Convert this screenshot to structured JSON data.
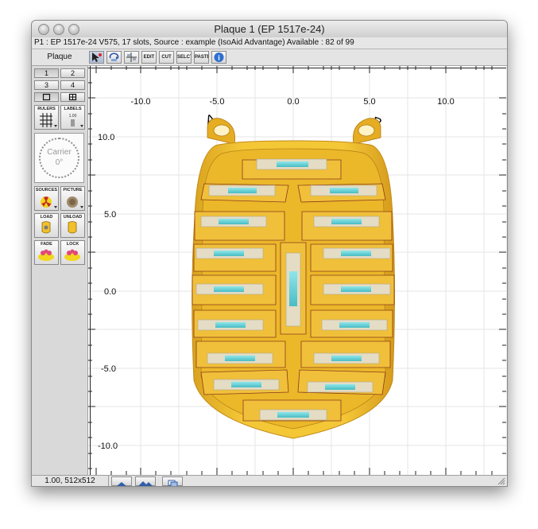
{
  "window": {
    "title": "Plaque 1 (EP 1517e-24)",
    "info": "P1 : EP 1517e-24 V575, 17 slots, Source : example (IsoAid Advantage) Available : 82 of 99"
  },
  "toolbar": {
    "plaque_label": "Plaque",
    "buttons": [
      {
        "name": "select-tool-button",
        "label": ""
      },
      {
        "name": "rotate-tool-button",
        "label": ""
      },
      {
        "name": "align-tool-button",
        "label": ""
      },
      {
        "name": "edit-button",
        "label": "EDIT"
      },
      {
        "name": "cut-button",
        "label": "CUT"
      },
      {
        "name": "select-all-button",
        "label": "SELCT"
      },
      {
        "name": "paste-button",
        "label": "PASTE"
      },
      {
        "name": "info-button",
        "label": "i"
      }
    ]
  },
  "palette": {
    "view_buttons": [
      "1",
      "2",
      "3",
      "4"
    ],
    "rulers_label": "RULERS",
    "labels_label": "LABELS",
    "labels_scale": "1.00",
    "carrier_label": "Carrier",
    "carrier_angle": "0°",
    "sources_label": "SOURCES",
    "picture_label": "PICTURE",
    "load_label": "LOAD",
    "unload_label": "UNLOAD",
    "fade_label": "FADE",
    "lock_label": "LOCK"
  },
  "status": {
    "zoom": "1.00, 512x512"
  },
  "plot": {
    "x_ticks": [
      "-10.0",
      "-5.0",
      "0.0",
      "5.0",
      "10.0"
    ],
    "y_ticks": [
      "10.0",
      "5.0",
      "0.0",
      "-5.0",
      "-10.0"
    ],
    "corner_a": "A",
    "corner_b": "B"
  },
  "colors": {
    "plaque_gold": "#f1c02a",
    "plaque_edge": "#8a3a1a",
    "seed_cyan": "#66d2d8",
    "slot_fill": "#e4dcc4"
  }
}
